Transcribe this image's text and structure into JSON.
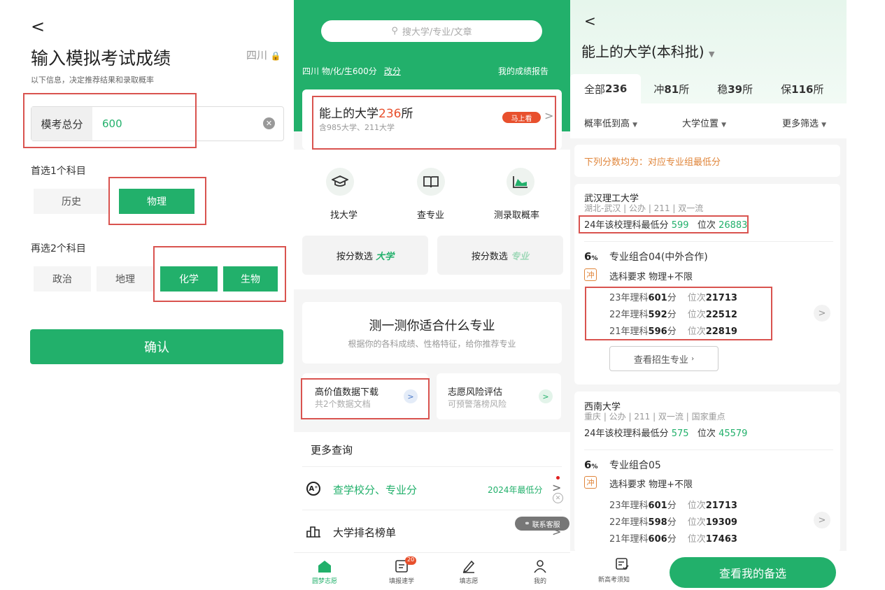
{
  "left": {
    "back_icon": "<",
    "title": "输入模拟考试成绩",
    "region": "四川",
    "subtitle": "以下信息，决定推荐结果和录取概率",
    "score_label": "模考总分",
    "score_value": "600",
    "first_label": "首选1个科目",
    "first_options": [
      "历史",
      "物理"
    ],
    "second_label": "再选2个科目",
    "second_options": [
      "政治",
      "地理",
      "化学",
      "生物"
    ],
    "confirm": "确认"
  },
  "middle": {
    "search_placeholder": "搜大学/专业/文章",
    "info": "四川 物/化/生600分",
    "change": "改分",
    "report": "我的成绩报告",
    "card_title_a": "能上的大学",
    "card_count": "236",
    "card_title_b": "所",
    "card_sub": "含985大学、211大学",
    "card_btn": "马上看",
    "icons": [
      "找大学",
      "查专业",
      "测录取概率"
    ],
    "select_btns": [
      {
        "prefix": "按分数选",
        "word": "大学"
      },
      {
        "prefix": "按分数选",
        "word": "专业"
      }
    ],
    "test_title": "测一测你适合什么专业",
    "test_sub": "根据你的各科成绩、性格特征，给你推荐专业",
    "mini": [
      {
        "t": "高价值数据下载",
        "s": "共2个数据文档"
      },
      {
        "t": "志愿风险评估",
        "s": "可预警落榜风险"
      }
    ],
    "more_title": "更多查询",
    "query_row": {
      "t": "查学校分、专业分",
      "r": "2024年最低分"
    },
    "rank_row": "大学排名榜单",
    "customer_service": "联系客服",
    "nav": [
      "圆梦志愿",
      "填报速学",
      "填志愿",
      "我的"
    ],
    "nav_badge": "20"
  },
  "right": {
    "back_icon": "<",
    "title": "能上的大学",
    "title_suffix": "(本科批)",
    "tabs": [
      {
        "a": "全部",
        "n": "236",
        "b": ""
      },
      {
        "a": "冲",
        "n": "81",
        "b": "所"
      },
      {
        "a": "稳",
        "n": "39",
        "b": "所"
      },
      {
        "a": "保",
        "n": "116",
        "b": "所"
      }
    ],
    "filters": [
      "概率低到高",
      "大学位置",
      "更多筛选"
    ],
    "notice": "下列分数均为：对应专业组最低分",
    "unis": [
      {
        "name": "武汉理工大学",
        "tags": "湖北-武汉 | 公办 | 211 | 双一流",
        "line_a": "24年该校理科最低分",
        "score": "599",
        "rank_label": "位次",
        "rank": "26883",
        "pct": "6",
        "group": "专业组合04(中外合作)",
        "req": "选科要求 物理+不限",
        "years": [
          {
            "y": "23年理科",
            "s": "601",
            "r": "21713"
          },
          {
            "y": "22年理科",
            "s": "592",
            "r": "22512"
          },
          {
            "y": "21年理科",
            "s": "596",
            "r": "22819"
          }
        ],
        "view": "查看招生专业"
      },
      {
        "name": "西南大学",
        "tags": "重庆 | 公办 | 211 | 双一流 | 国家重点",
        "line_a": "24年该校理科最低分",
        "score": "575",
        "rank_label": "位次",
        "rank": "45579",
        "pct": "6",
        "group": "专业组合05",
        "req": "选科要求 物理+不限",
        "years": [
          {
            "y": "23年理科",
            "s": "601",
            "r": "21713"
          },
          {
            "y": "22年理科",
            "s": "598",
            "r": "19309"
          },
          {
            "y": "21年理科",
            "s": "606",
            "r": "17463"
          }
        ]
      }
    ],
    "chong": "冲",
    "score_unit": "分",
    "pct_unit": "%",
    "rank_word": "位次",
    "bottom_label": "新高考须知",
    "bottom_btn": "查看我的备选"
  },
  "colors": {
    "green": "#22b06b",
    "red_box": "#d9534f",
    "orange": "#e8502d"
  }
}
